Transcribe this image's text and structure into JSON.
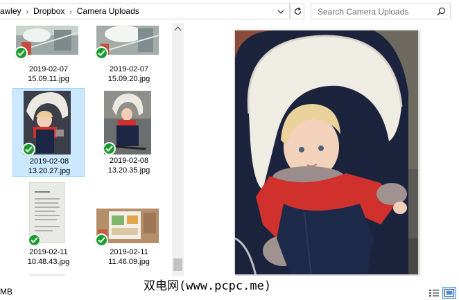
{
  "address_bar": {
    "crumbs": [
      "awley",
      "Dropbox",
      "Camera Uploads"
    ],
    "dropdown_icon": "chevron-down-icon",
    "refresh_icon": "refresh-icon"
  },
  "search": {
    "placeholder": "Search Camera Uploads",
    "icon": "search-icon"
  },
  "files": [
    {
      "date": "2019-02-07",
      "time": "15.09.11.jpg",
      "synced": true,
      "selected": false
    },
    {
      "date": "2019-02-07",
      "time": "15.09.20.jpg",
      "synced": true,
      "selected": false
    },
    {
      "date": "2019-02-08",
      "time": "13.20.27.jpg",
      "synced": true,
      "selected": true
    },
    {
      "date": "2019-02-08",
      "time": "13.20.35.jpg",
      "synced": true,
      "selected": false
    },
    {
      "date": "2019-02-11",
      "time": "10.48.43.jpg",
      "synced": true,
      "selected": false
    },
    {
      "date": "2019-02-11",
      "time": "11.46.09.jpg",
      "synced": true,
      "selected": false
    }
  ],
  "status_bar": {
    "size_text": "MB",
    "watermark": "双电网(www.pcpc.me)",
    "view_icons": [
      "details-view-icon",
      "large-icons-view-icon"
    ]
  },
  "colors": {
    "selection_bg": "#cce8ff",
    "selection_border": "#99d1ff",
    "sync_check": "#1a9c2e"
  }
}
